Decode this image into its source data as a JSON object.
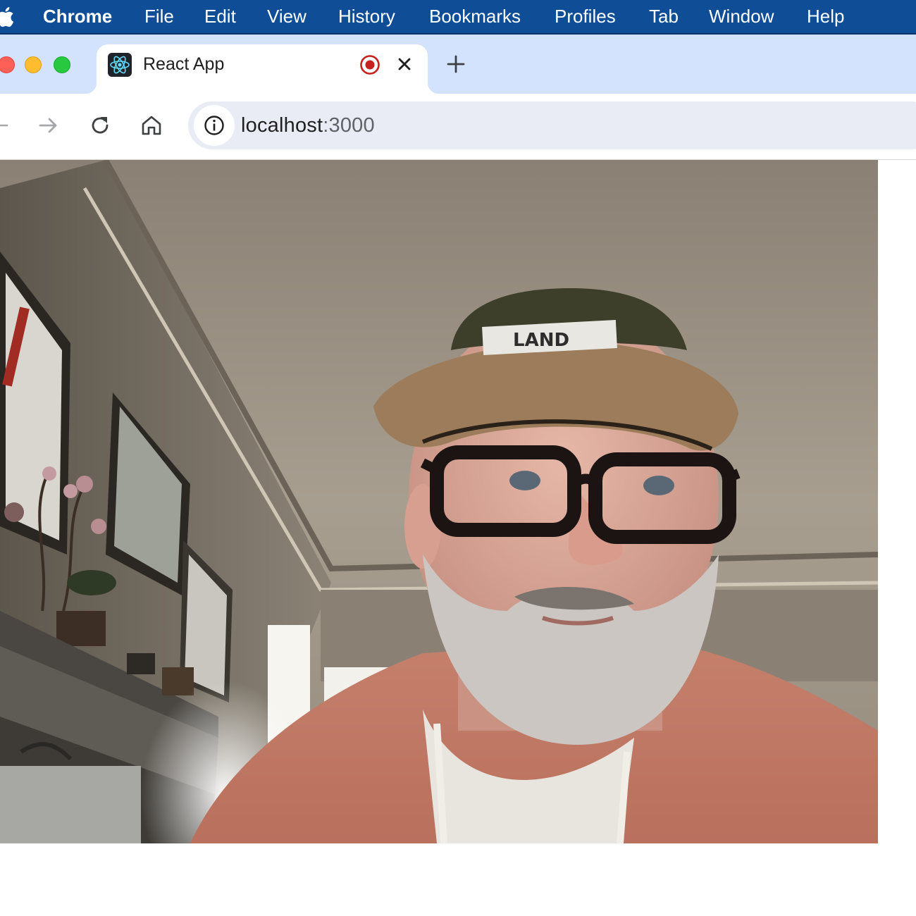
{
  "menubar": {
    "apple": "apple-logo",
    "items": [
      {
        "label": "Chrome",
        "bold": true
      },
      {
        "label": "File"
      },
      {
        "label": "Edit"
      },
      {
        "label": "View"
      },
      {
        "label": "History"
      },
      {
        "label": "Bookmarks"
      },
      {
        "label": "Profiles"
      },
      {
        "label": "Tab"
      },
      {
        "label": "Window"
      },
      {
        "label": "Help"
      }
    ]
  },
  "tabs": [
    {
      "title": "React App",
      "favicon": "react-icon",
      "recording": true,
      "active": true
    }
  ],
  "address": {
    "host": "localhost",
    "port": ":3000"
  },
  "video": {
    "description": "webcam-feed",
    "hat_text": "LAND"
  },
  "colors": {
    "menubar": "#0f4e97",
    "tabstrip": "#d3e3fd",
    "omnibox": "#e9ecf4",
    "record": "#c5221f"
  }
}
